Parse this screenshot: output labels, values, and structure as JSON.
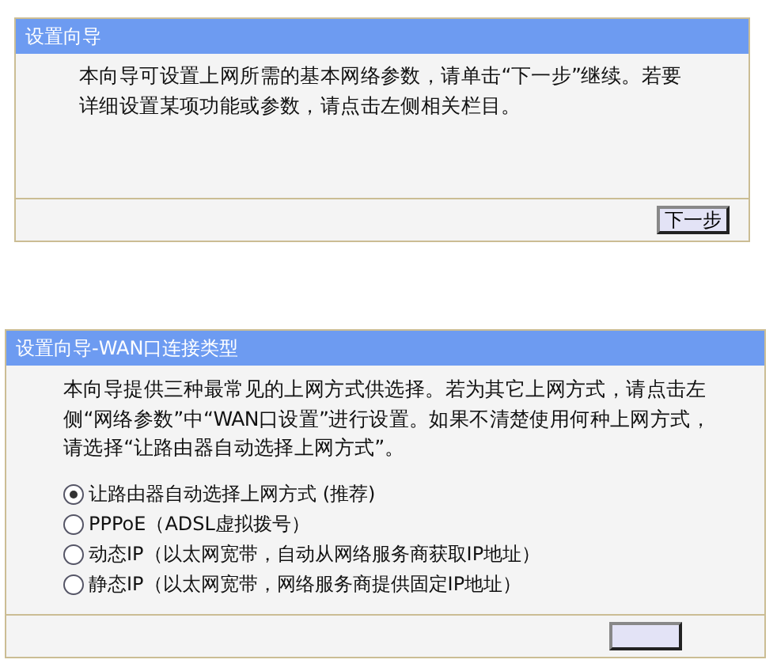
{
  "panels": [
    {
      "title": "设置向导",
      "paragraph": "本向导可设置上网所需的基本网络参数，请单击“下一步”继续。若要详细设置某项功能或参数，请点击左侧相关栏目。",
      "button": "下一步"
    },
    {
      "title": "设置向导-WAN口连接类型",
      "paragraph": "本向导提供三种最常见的上网方式供选择。若为其它上网方式，请点击左侧“网络参数”中“WAN口设置”进行设置。如果不清楚使用何种上网方式，请选择“让路由器自动选择上网方式”。",
      "options": [
        {
          "label": "让路由器自动选择上网方式 (推荐)",
          "selected": true
        },
        {
          "label": "PPPoE（ADSL虚拟拨号）",
          "selected": false
        },
        {
          "label": "动态IP（以太网宽带，自动从网络服务商获取IP地址）",
          "selected": false
        },
        {
          "label": "静态IP（以太网宽带，网络服务商提供固定IP地址）",
          "selected": false
        }
      ]
    }
  ]
}
